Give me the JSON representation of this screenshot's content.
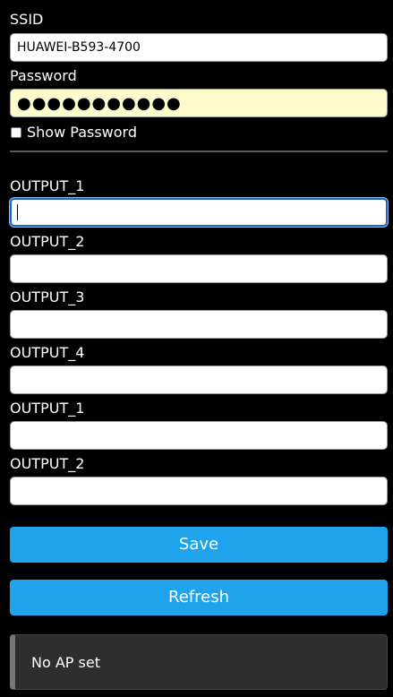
{
  "wifi": {
    "ssid_label": "SSID",
    "ssid_value": "HUAWEI-B593-4700",
    "password_label": "Password",
    "password_value": "●●●●●●●●●●●",
    "show_password_label": "Show Password"
  },
  "outputs": [
    {
      "label": "OUTPUT_1",
      "value": ""
    },
    {
      "label": "OUTPUT_2",
      "value": ""
    },
    {
      "label": "OUTPUT_3",
      "value": ""
    },
    {
      "label": "OUTPUT_4",
      "value": ""
    },
    {
      "label": "OUTPUT_1",
      "value": ""
    },
    {
      "label": "OUTPUT_2",
      "value": ""
    }
  ],
  "buttons": {
    "save_label": "Save",
    "refresh_label": "Refresh"
  },
  "status": {
    "message": "No AP set"
  },
  "colors": {
    "background": "#000000",
    "button": "#1fa3ec",
    "password_bg": "#fefccd"
  }
}
